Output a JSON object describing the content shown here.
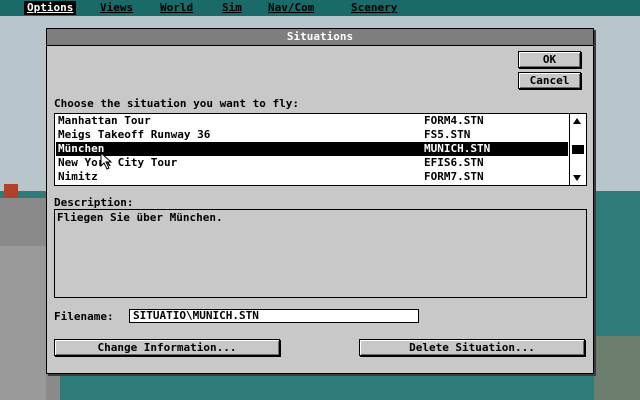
{
  "menubar": {
    "items": [
      {
        "label": "Options",
        "active": true
      },
      {
        "label": "Views"
      },
      {
        "label": "World"
      },
      {
        "label": "Sim"
      },
      {
        "label": "Nav/Com"
      },
      {
        "label": "Scenery"
      }
    ]
  },
  "dialog": {
    "title": "Situations",
    "ok_label": "OK",
    "cancel_label": "Cancel",
    "choose_label": "Choose the situation you want to fly:",
    "situations": [
      {
        "name": "Manhattan Tour",
        "file": "FORM4.STN"
      },
      {
        "name": "Meigs Takeoff Runway 36",
        "file": "FS5.STN"
      },
      {
        "name": "München",
        "file": "MUNICH.STN",
        "selected": true
      },
      {
        "name": "New York City Tour",
        "file": "EFIS6.STN"
      },
      {
        "name": "Nimitz",
        "file": "FORM7.STN"
      }
    ],
    "description_label": "Description:",
    "description_text": "Fliegen Sie über München.",
    "filename_label": "Filename:",
    "filename_value": "SITUATIO\\MUNICH.STN",
    "change_button": "Change Information...",
    "delete_button": "Delete Situation..."
  }
}
